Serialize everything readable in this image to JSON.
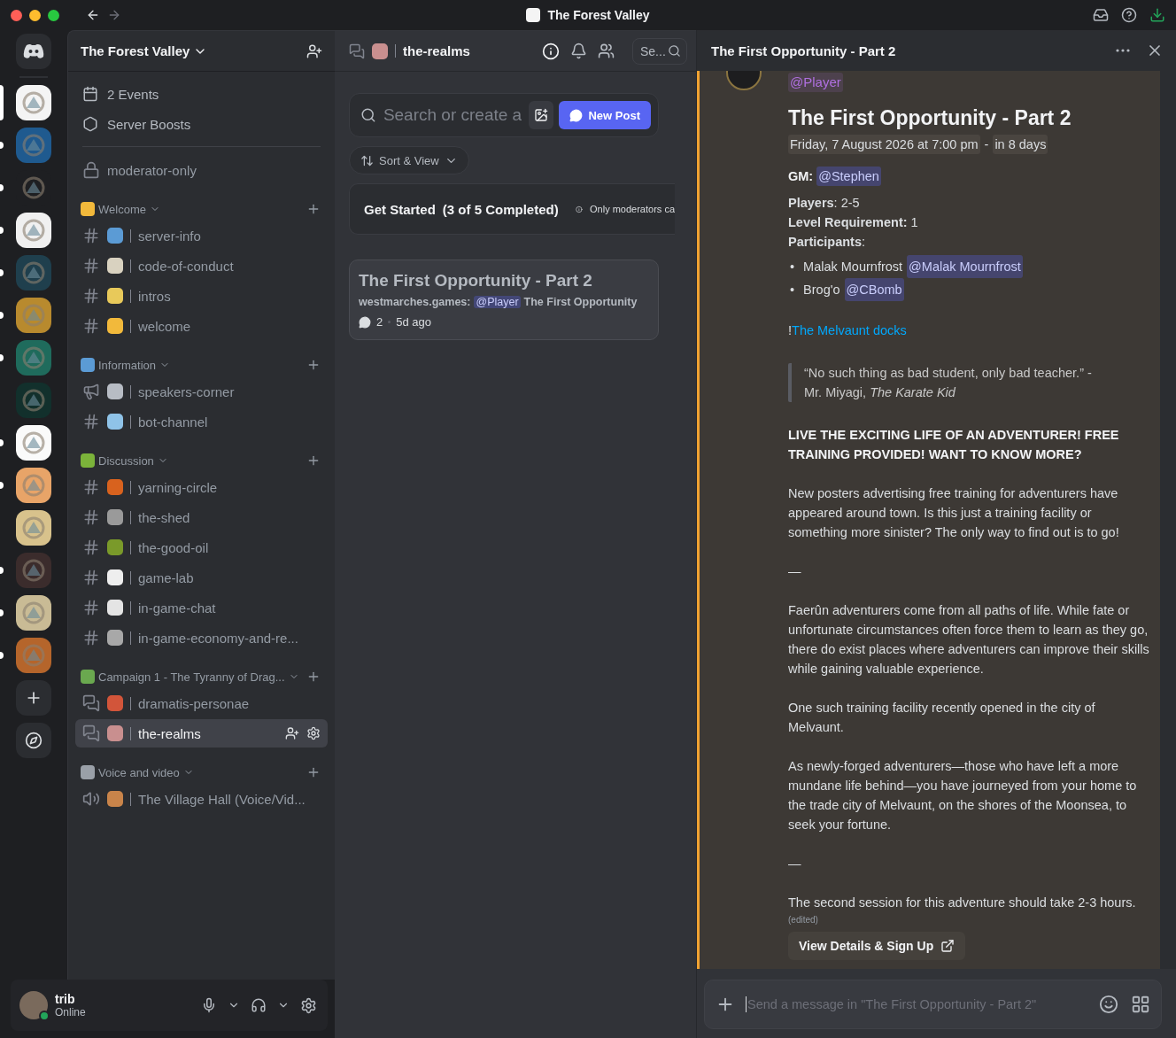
{
  "titlebar": {
    "title": "The Forest Valley"
  },
  "servers": [
    {
      "color": "#f4f4f4",
      "selected": true,
      "unread": false
    },
    {
      "color": "#1f5a8f",
      "selected": false,
      "unread": true
    },
    {
      "color": "#1e1f22",
      "selected": false,
      "unread": true
    },
    {
      "color": "#f0f0f0",
      "selected": false,
      "unread": true
    },
    {
      "color": "#1f3f4d",
      "selected": false,
      "unread": true
    },
    {
      "color": "#b88a2e",
      "selected": false,
      "unread": true
    },
    {
      "color": "#1f6b5c",
      "selected": false,
      "unread": true
    },
    {
      "color": "#12302c",
      "selected": false,
      "unread": false
    },
    {
      "color": "#fafafa",
      "selected": false,
      "unread": true
    },
    {
      "color": "#e8a468",
      "selected": false,
      "unread": true
    },
    {
      "color": "#d8c28c",
      "selected": false,
      "unread": false
    },
    {
      "color": "#3b2c2c",
      "selected": false,
      "unread": true
    },
    {
      "color": "#c9bb95",
      "selected": false,
      "unread": true
    },
    {
      "color": "#b5652b",
      "selected": false,
      "unread": true
    }
  ],
  "sidebar": {
    "server_name": "The Forest Valley",
    "events": "2 Events",
    "boosts": "Server Boosts",
    "top_channels": [
      {
        "kind": "locked",
        "name": "moderator-only",
        "selected": false
      }
    ],
    "categories": [
      {
        "name": "Welcome",
        "color": "#f2b93b",
        "channels": [
          {
            "kind": "text",
            "color": "#5b9bd5",
            "name": "server-info",
            "selected": false
          },
          {
            "kind": "text",
            "color": "#d9d2c0",
            "name": "code-of-conduct",
            "selected": false
          },
          {
            "kind": "text",
            "color": "#e8c95a",
            "name": "intros",
            "selected": false
          },
          {
            "kind": "text",
            "color": "#f2b93b",
            "name": "welcome",
            "selected": false
          }
        ]
      },
      {
        "name": "Information",
        "color": "#5b9bd5",
        "channels": [
          {
            "kind": "announcement",
            "color": "#b7bcc4",
            "name": "speakers-corner",
            "selected": false
          },
          {
            "kind": "text",
            "color": "#8fc3e8",
            "name": "bot-channel",
            "selected": false
          }
        ]
      },
      {
        "name": "Discussion",
        "color": "#7bb33a",
        "channels": [
          {
            "kind": "text",
            "color": "#d8621e",
            "name": "yarning-circle",
            "selected": false
          },
          {
            "kind": "text",
            "color": "#9a9a9a",
            "name": "the-shed",
            "selected": false
          },
          {
            "kind": "text",
            "color": "#7a9a2a",
            "name": "the-good-oil",
            "selected": false
          },
          {
            "kind": "text",
            "color": "#eeeeee",
            "name": "game-lab",
            "selected": false
          },
          {
            "kind": "text",
            "color": "#e4e4e4",
            "name": "in-game-chat",
            "selected": false
          },
          {
            "kind": "text",
            "color": "#a8a8a8",
            "name": "in-game-economy-and-re...",
            "selected": false
          }
        ]
      },
      {
        "name": "Campaign 1 - The Tyranny of Drag...",
        "color": "#6aa84f",
        "channels": [
          {
            "kind": "forum",
            "color": "#d2553a",
            "name": "dramatis-personae",
            "selected": false
          },
          {
            "kind": "forum",
            "color": "#c98f8f",
            "name": "the-realms",
            "selected": true
          }
        ]
      },
      {
        "name": "Voice and video",
        "color": "#9aa0a8",
        "channels": [
          {
            "kind": "voice",
            "color": "#c9844a",
            "name": "The Village Hall (Voice/Vid...",
            "selected": false
          }
        ]
      }
    ]
  },
  "user": {
    "name": "trib",
    "status": "Online"
  },
  "forum": {
    "channel": "the-realms",
    "search": "Se...",
    "post_search": {
      "placeholder": "Search or create a"
    },
    "new_post": "New Post",
    "sort": "Sort & View",
    "get_started": "Get Started",
    "progress": "(3 of 5 Completed)",
    "notice": "Only moderators ca",
    "post": {
      "title": "The First Opportunity - Part 2",
      "author": "westmarches.games:",
      "mention": "@Player",
      "preview": "The First Opportunity",
      "replies": "2",
      "age": "5d ago"
    }
  },
  "thread": {
    "title": "The First Opportunity - Part 2",
    "role_mention": "@Player",
    "heading": "The First Opportunity - Part 2",
    "date": "Friday, 7 August 2026 at 7:00 pm",
    "date_sep": "-",
    "relative": "in 8 days",
    "gm_label": "GM:",
    "gm": "@Stephen",
    "facts": [
      "**Players**: 2-5",
      "**Level Requirement:** 1",
      "**Participants**:"
    ],
    "participants": [
      {
        "bullet": "•",
        "name": "Malak Mournfrost",
        "mention": "@Malak Mournfrost"
      },
      {
        "bullet": "•",
        "name": "Brog'o",
        "mention": "@CBomb"
      }
    ],
    "bang": "!",
    "link": "The Melvaunt docks",
    "quote": [
      "“No such thing as bad student, only bad teacher.” -",
      "Mr. Miyagi, *The Karate Kid*"
    ],
    "blocks": [
      {
        "kind": "caps",
        "text": "LIVE THE EXCITING LIFE OF AN ADVENTURER! FREE TRAINING PROVIDED! WANT TO KNOW MORE?"
      },
      {
        "kind": "para",
        "text": "New posters advertising free training for adventurers have appeared around town. Is this just a training facility or something more sinister? The only way to find out is to go!"
      },
      {
        "kind": "rule",
        "text": "—"
      },
      {
        "kind": "para",
        "text": "Faerûn adventurers come from all paths of life. While fate or unfortunate circumstances often force them to learn as they go, there do exist places where adventurers can improve their skills while gaining valuable experience."
      },
      {
        "kind": "para",
        "text": "One such training facility recently opened in the city of Melvaunt."
      },
      {
        "kind": "para",
        "text": "As newly-forged adventurers—those who have left a more mundane life behind—you have journeyed from your home to the trade city of Melvaunt, on the shores of the Moonsea, to seek your fortune."
      },
      {
        "kind": "rule",
        "text": "—"
      },
      {
        "kind": "para",
        "text": "The second session for this adventure should take 2-3 hours."
      }
    ],
    "edited": "(edited)",
    "signup": "View Details & Sign Up",
    "composer_placeholder": "Send a message in \"The First Opportunity - Part 2\""
  }
}
